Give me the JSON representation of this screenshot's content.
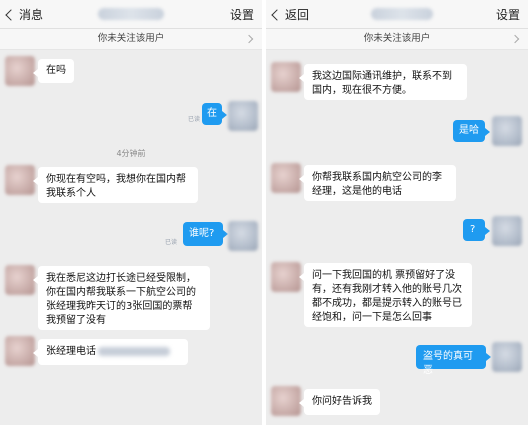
{
  "left": {
    "back_label": "消息",
    "settings_label": "设置",
    "notice": "你未关注该用户",
    "timestamp": "4分钟前",
    "messages": [
      {
        "text": "在吗"
      },
      {
        "text": "在",
        "status": "已读"
      },
      {
        "text": "你现在有空吗，我想你在国内帮我联系个人"
      },
      {
        "text": "谁呢?",
        "status": "已读"
      },
      {
        "text": "我在悉尼这边打长途已经受限制，你在国内帮我联系一下航空公司的张经理我昨天订的3张回国的票帮我预留了没有"
      },
      {
        "text": "张经理电话"
      }
    ]
  },
  "right": {
    "back_label": "返回",
    "settings_label": "设置",
    "notice": "你未关注该用户",
    "messages": [
      {
        "text": "我这边国际通讯维护，联系不到国内，现在很不方便。"
      },
      {
        "text": "是哈"
      },
      {
        "text": "你帮我联系国内航空公司的李经理，这是他的电话"
      },
      {
        "text": "?"
      },
      {
        "text": "问一下我回国的机 票预留好了没有，还有我刚才转入他的账号几次都不成功，都是提示转入的账号已经饱和，问一下是怎么回事"
      },
      {
        "text": "盗号的真可恶"
      },
      {
        "text": "你问好告诉我"
      }
    ]
  },
  "colors": {
    "outgoing_bubble": "#1f9bf0",
    "incoming_bubble": "#ffffff",
    "chat_background": "#ededed"
  },
  "icons": [
    "back-chevron-icon",
    "chevron-right-icon"
  ]
}
